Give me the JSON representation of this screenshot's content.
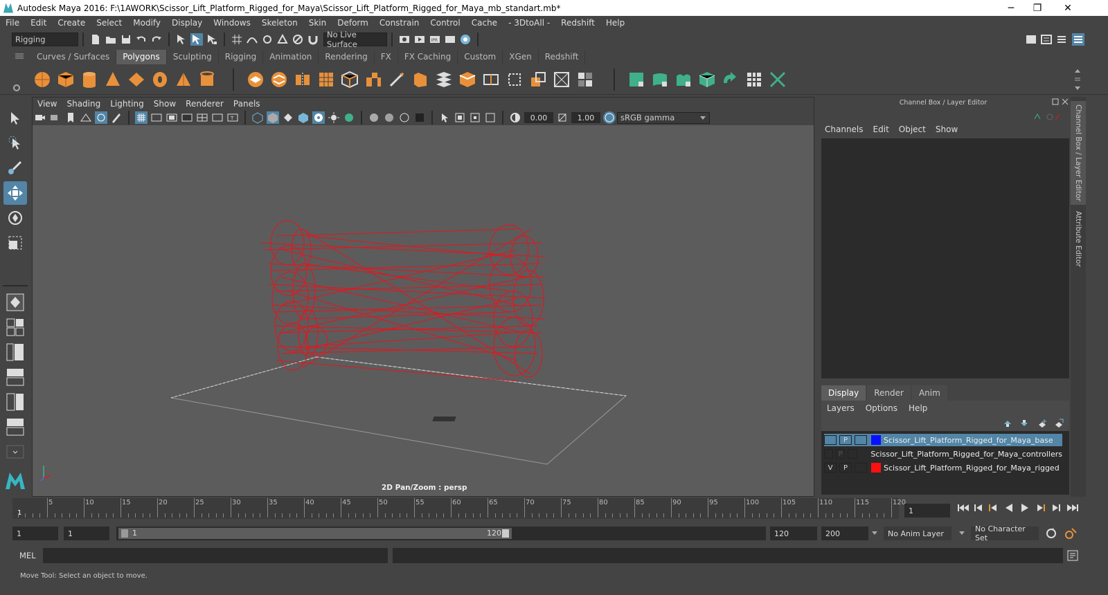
{
  "window": {
    "title": "Autodesk Maya 2016: F:\\1AWORK\\Scissor_Lift_Platform_Rigged_for_Maya\\Scissor_Lift_Platform_Rigged_for_Maya_mb_standart.mb*",
    "minimize": "─",
    "maximize": "❐",
    "close": "✕"
  },
  "menubar": [
    "File",
    "Edit",
    "Create",
    "Select",
    "Modify",
    "Display",
    "Windows",
    "Skeleton",
    "Skin",
    "Deform",
    "Constrain",
    "Control",
    "Cache",
    "- 3DtoAll -",
    "Redshift",
    "Help"
  ],
  "statusline": {
    "mode": "Rigging",
    "live_surface": "No Live Surface"
  },
  "shelf_tabs": [
    "Curves / Surfaces",
    "Polygons",
    "Sculpting",
    "Rigging",
    "Animation",
    "Rendering",
    "FX",
    "FX Caching",
    "Custom",
    "XGen",
    "Redshift"
  ],
  "shelf_active": "Polygons",
  "panel_menu": [
    "View",
    "Shading",
    "Lighting",
    "Show",
    "Renderer",
    "Panels"
  ],
  "panel_tools": {
    "exposure": "0.00",
    "gamma": "1.00",
    "color_space": "sRGB gamma"
  },
  "viewport": {
    "label": "2D Pan/Zoom : persp",
    "background": "#5c5c5c",
    "wire_color": "#e8141c"
  },
  "channel_box": {
    "title": "Channel Box / Layer Editor",
    "menu": [
      "Channels",
      "Edit",
      "Object",
      "Show"
    ]
  },
  "layer_editor": {
    "tabs": [
      "Display",
      "Render",
      "Anim"
    ],
    "active_tab": "Display",
    "menu": [
      "Layers",
      "Options",
      "Help"
    ],
    "layers": [
      {
        "v": "",
        "p": "P",
        "color": "#0a10ff",
        "name": "Scissor_Lift_Platform_Rigged_for_Maya_base",
        "selected": true
      },
      {
        "v": "",
        "p": "P",
        "color": "",
        "name": "Scissor_Lift_Platform_Rigged_for_Maya_controllers",
        "selected": false
      },
      {
        "v": "V",
        "p": "P",
        "color": "#ff1010",
        "name": "Scissor_Lift_Platform_Rigged_for_Maya_rigged",
        "selected": false
      }
    ]
  },
  "side_tabs": [
    "Channel Box / Layer Editor",
    "Attribute Editor"
  ],
  "timeline": {
    "ticks": [
      "5",
      "10",
      "15",
      "20",
      "25",
      "30",
      "35",
      "40",
      "45",
      "50",
      "55",
      "60",
      "65",
      "70",
      "75",
      "80",
      "85",
      "90",
      "95",
      "100",
      "105",
      "110",
      "115",
      "120"
    ],
    "first_frame": "1",
    "current_frame": "1"
  },
  "range": {
    "start": "1",
    "playback_start": "1",
    "slider_start": "1",
    "slider_end": "120",
    "playback_end": "120",
    "end": "200",
    "anim_layer": "No Anim Layer",
    "character_set": "No Character Set"
  },
  "command": {
    "lang": "MEL"
  },
  "help_line": "Move Tool: Select an object to move.",
  "colors": {
    "accent": "#5285a6",
    "panel": "#444444",
    "field": "#2b2b2b",
    "shelf_icon": "#e8913a",
    "shelf_green": "#3fb08a"
  }
}
